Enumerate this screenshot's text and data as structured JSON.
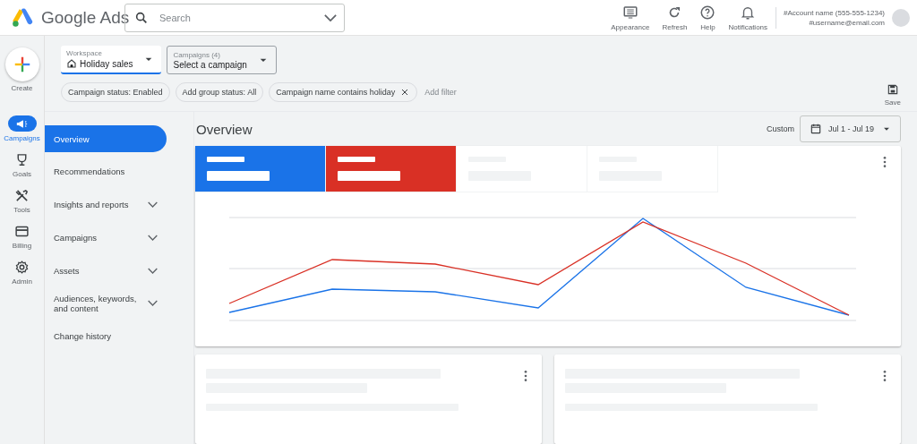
{
  "header": {
    "product": "Google Ads",
    "search": {
      "placeholder": "Search"
    },
    "actions": [
      {
        "kind": "appearance",
        "label": "Appearance"
      },
      {
        "kind": "refresh",
        "label": "Refresh"
      },
      {
        "kind": "help",
        "label": "Help"
      },
      {
        "kind": "notifications",
        "label": "Notifications"
      }
    ],
    "account": {
      "name": "#Account name (555-555-1234)",
      "email": "#username@email.com"
    }
  },
  "rail": {
    "create": "Create",
    "items": [
      {
        "kind": "campaigns",
        "label": "Campaigns",
        "selected": true
      },
      {
        "kind": "goals",
        "label": "Goals",
        "selected": false
      },
      {
        "kind": "tools",
        "label": "Tools",
        "selected": false
      },
      {
        "kind": "billing",
        "label": "Billing",
        "selected": false
      },
      {
        "kind": "admin",
        "label": "Admin",
        "selected": false
      }
    ]
  },
  "pickers": [
    {
      "label": "Workspace",
      "value": "Holiday sales",
      "selected": true
    },
    {
      "label": "Campaigns (4)",
      "value": "Select a campaign",
      "selected": false
    }
  ],
  "filters": [
    {
      "label": "Campaign status: Enabled",
      "removable": false
    },
    {
      "label": "Add group status: All",
      "removable": false
    },
    {
      "label": "Campaign name contains holiday",
      "removable": true
    }
  ],
  "add_filter": "Add filter",
  "save": "Save",
  "nav": [
    {
      "label": "Overview",
      "selected": true,
      "expandable": false
    },
    {
      "label": "Recommendations",
      "selected": false,
      "expandable": false
    },
    {
      "label": "Insights and reports",
      "selected": false,
      "expandable": true
    },
    {
      "label": "Campaigns",
      "selected": false,
      "expandable": true
    },
    {
      "label": "Assets",
      "selected": false,
      "expandable": true
    },
    {
      "label": "Audiences, keywords, and content",
      "selected": false,
      "expandable": true
    },
    {
      "label": "Change history",
      "selected": false,
      "expandable": false
    }
  ],
  "page_title": "Overview",
  "date_range": {
    "preset": "Custom",
    "range": "Jul 1 - Jul 19"
  },
  "metrics": [
    {
      "selected": true,
      "color": "#1a73e8"
    },
    {
      "selected": true,
      "color": "#d93025"
    },
    {
      "selected": false
    },
    {
      "selected": false
    }
  ]
}
